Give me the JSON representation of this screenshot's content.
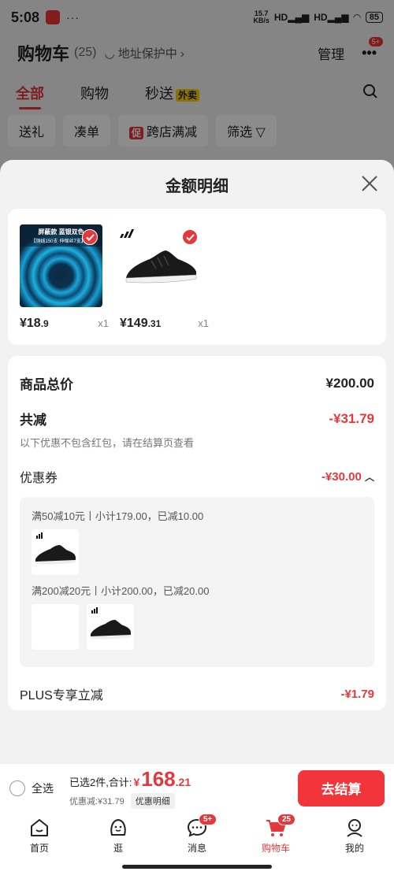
{
  "status_bar": {
    "time": "5:08",
    "dots": "···",
    "net_speed_top": "15.7",
    "net_speed_bottom": "KB/s",
    "signal1": "HD",
    "signal2": "HD",
    "battery": "85"
  },
  "cart_header": {
    "title": "购物车",
    "count": "(25)",
    "address_protect": "地址保护中",
    "manage": "管理",
    "more_badge": "5+"
  },
  "cart_tabs": {
    "all": "全部",
    "shopping": "购物",
    "flash": "秒送",
    "flash_tag": "外卖"
  },
  "filters": {
    "gift": "送礼",
    "bundle": "凑单",
    "promo_tag": "促",
    "cross_store": "跨店满减",
    "filter": "筛选"
  },
  "sheet": {
    "title": "金额明细",
    "products": [
      {
        "price_int": "¥18",
        "price_dec": ".9",
        "qty": "x1",
        "banner_line1": "屏蔽款 蓝银双色",
        "banner_line2": "【铜线150支·伸缩丝7支】71"
      },
      {
        "price_int": "¥149",
        "price_dec": ".31",
        "qty": "x1"
      }
    ],
    "total_label": "商品总价",
    "total_value": "¥200.00",
    "discount_label": "共减",
    "discount_value": "-¥31.79",
    "discount_note": "以下优惠不包含红包，请在结算页查看",
    "coupon_label": "优惠券",
    "coupon_value": "-¥30.00",
    "coupon_lines": [
      "满50减10元丨小计179.00，已减10.00",
      "满200减20元丨小计200.00，已减20.00"
    ],
    "plus_label": "PLUS专享立减",
    "plus_value": "-¥1.79"
  },
  "checkout": {
    "select_all": "全选",
    "selected_text": "已选2件,合计:",
    "currency": "¥",
    "total_int": "168",
    "total_dec": ".21",
    "discount_text": "优惠减:¥31.79",
    "detail_tag": "优惠明细",
    "button": "去结算"
  },
  "tabbar": {
    "home": "首页",
    "browse": "逛",
    "messages": "消息",
    "messages_badge": "5+",
    "cart": "购物车",
    "cart_badge": "25",
    "mine": "我的"
  },
  "colors": {
    "accent": "#e4393c",
    "checkout_button": "#f2353b"
  }
}
